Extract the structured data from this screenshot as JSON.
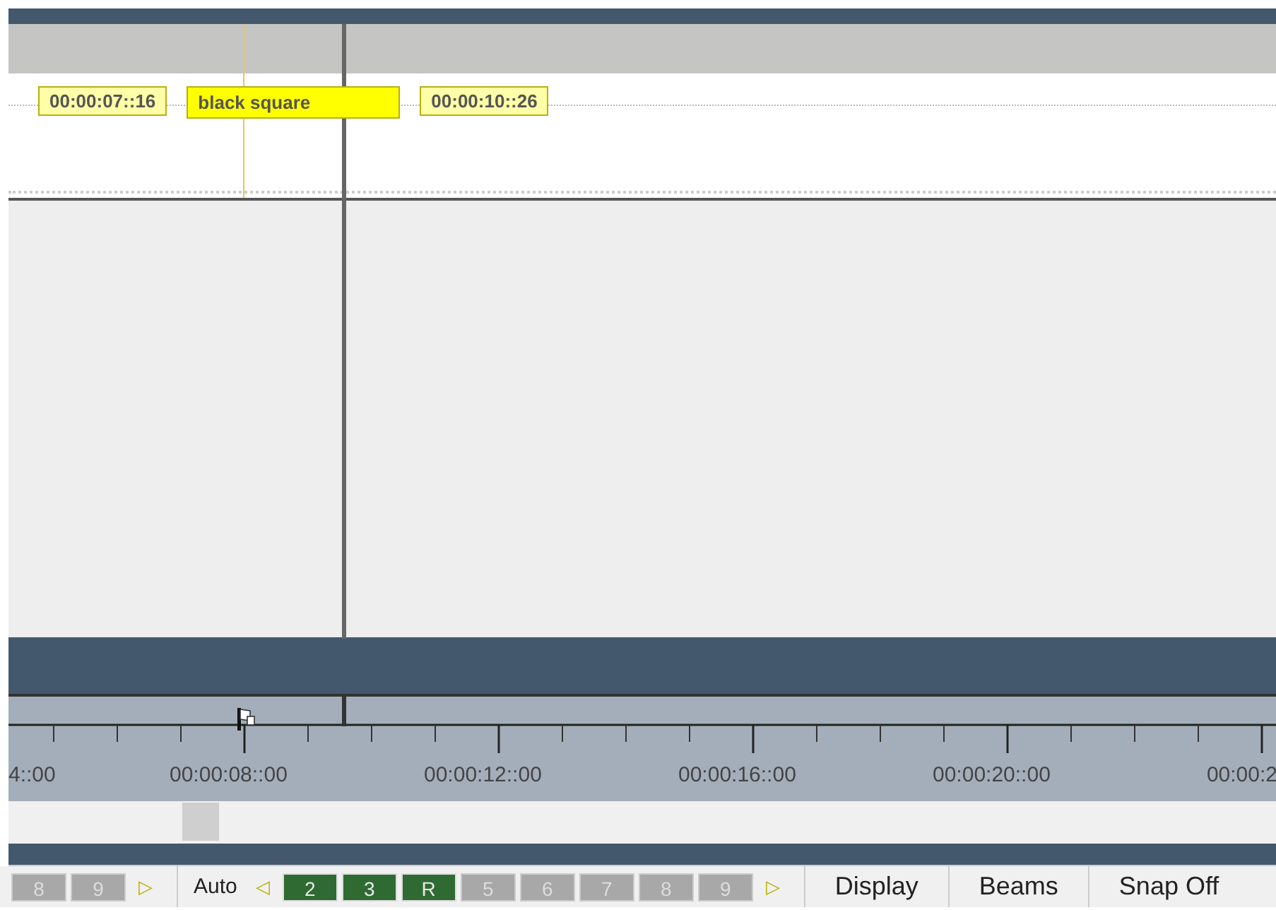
{
  "track": {
    "clips": [
      {
        "kind": "timecode",
        "text": "00:00:07::16"
      },
      {
        "kind": "title",
        "text": "black square"
      },
      {
        "kind": "timecode",
        "text": "00:00:10::26"
      }
    ]
  },
  "ruler": {
    "labels": [
      "4::00",
      "00:00:08::00",
      "00:00:12::00",
      "00:00:16::00",
      "00:00:20::00",
      "00:00:2"
    ]
  },
  "toolbar": {
    "items": [
      {
        "kind": "key",
        "text": "8",
        "selected": false
      },
      {
        "kind": "key",
        "text": "9",
        "selected": false
      },
      {
        "kind": "arrow",
        "text": "▷"
      },
      {
        "kind": "sep"
      },
      {
        "kind": "label",
        "text": "Auto"
      },
      {
        "kind": "arrow",
        "text": "◁"
      },
      {
        "kind": "key",
        "text": "2",
        "selected": true
      },
      {
        "kind": "key",
        "text": "3",
        "selected": true
      },
      {
        "kind": "key",
        "text": "R",
        "selected": true
      },
      {
        "kind": "key",
        "text": "5",
        "selected": false
      },
      {
        "kind": "key",
        "text": "6",
        "selected": false
      },
      {
        "kind": "key",
        "text": "7",
        "selected": false
      },
      {
        "kind": "key",
        "text": "8",
        "selected": false
      },
      {
        "kind": "key",
        "text": "9",
        "selected": false
      },
      {
        "kind": "arrow",
        "text": "▷"
      },
      {
        "kind": "sep"
      },
      {
        "kind": "button",
        "text": "Display"
      },
      {
        "kind": "sep"
      },
      {
        "kind": "button",
        "text": "Beams"
      },
      {
        "kind": "sep"
      },
      {
        "kind": "button",
        "text": "Snap Off"
      }
    ]
  }
}
